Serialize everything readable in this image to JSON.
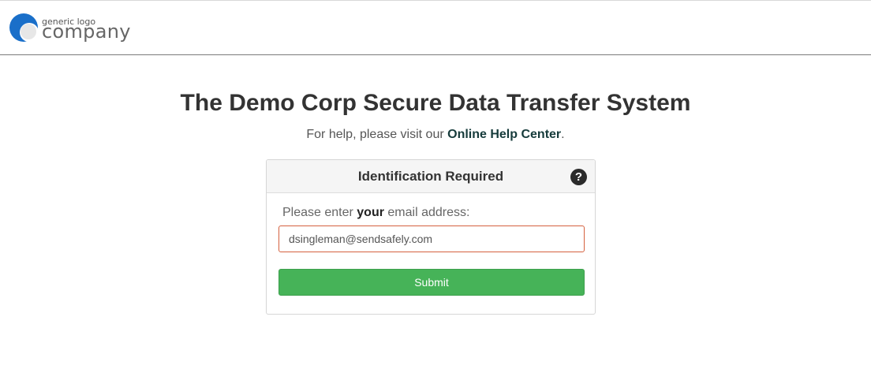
{
  "header": {
    "logo_small": "generic logo",
    "logo_big": "company"
  },
  "main": {
    "title": "The Demo Corp Secure Data Transfer System",
    "help_prefix": "For help, please visit our ",
    "help_link": "Online Help Center",
    "help_suffix": "."
  },
  "panel": {
    "title": "Identification Required",
    "help_icon_glyph": "?",
    "prompt_before": "Please enter ",
    "prompt_bold": "your",
    "prompt_after": " email address:",
    "email_value": "dsingleman@sendsafely.com",
    "submit_label": "Submit"
  },
  "colors": {
    "submit": "#46b358",
    "input_border": "#d5613f",
    "link": "#163b3b",
    "logo_blue": "#1a6fc9"
  },
  "icons": {
    "logo": "circle-logo-icon",
    "help": "question-circle-icon"
  }
}
